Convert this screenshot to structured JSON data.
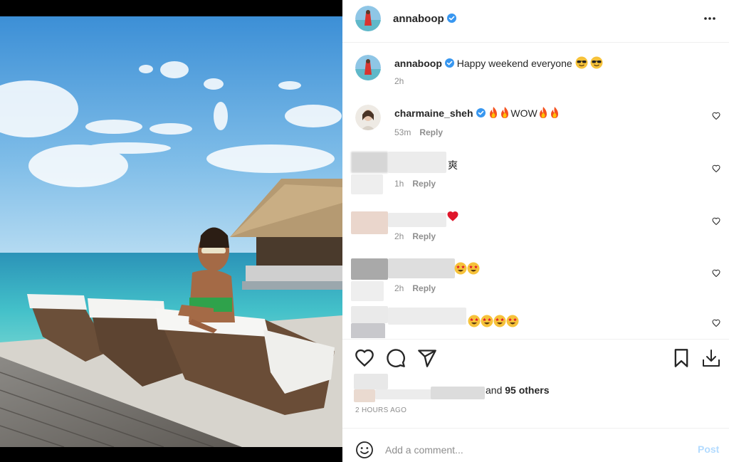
{
  "post": {
    "author": "annaboop",
    "author_verified": true,
    "photo_alt": "Woman in green swimsuit leaning on a white lounge chair on a deck by the sea"
  },
  "header": {
    "username": "annaboop",
    "more_icon": "more-horizontal-icon"
  },
  "caption": {
    "username": "annaboop",
    "text": "Happy weekend everyone",
    "emoji": [
      "😎",
      "😎"
    ],
    "time": "2h"
  },
  "comments": [
    {
      "username": "charmaine_sheh",
      "verified": true,
      "text": "WOW",
      "emoji_before": [
        "🔥",
        "🔥"
      ],
      "emoji_after": [
        "🔥",
        "🔥"
      ],
      "time": "53m",
      "reply": "Reply",
      "blurred": false
    },
    {
      "username": "",
      "verified": false,
      "text": "爽",
      "time": "1h",
      "reply": "Reply",
      "blurred": true
    },
    {
      "username": "",
      "verified": false,
      "text": "❤️",
      "time": "2h",
      "reply": "Reply",
      "blurred": true
    },
    {
      "username": "",
      "verified": false,
      "text": "🤩🤩",
      "time": "2h",
      "reply": "Reply",
      "blurred": true
    },
    {
      "username": "",
      "verified": false,
      "text": "🤩🤩🤩🤩",
      "time": "",
      "reply": "",
      "blurred": true
    }
  ],
  "actions": {
    "icons": [
      "heart-icon",
      "comment-icon",
      "share-icon",
      "bookmark-icon",
      "download-icon"
    ]
  },
  "likes": {
    "prefix": "and",
    "count": "95 others"
  },
  "timestamp": "2 HOURS AGO",
  "add_comment": {
    "placeholder": "Add a comment...",
    "post_label": "Post"
  },
  "colors": {
    "verified_blue": "#3897f0",
    "post_disabled": "#b3dbff",
    "muted": "#8e8e8e",
    "text": "#262626",
    "border": "#efefef"
  }
}
